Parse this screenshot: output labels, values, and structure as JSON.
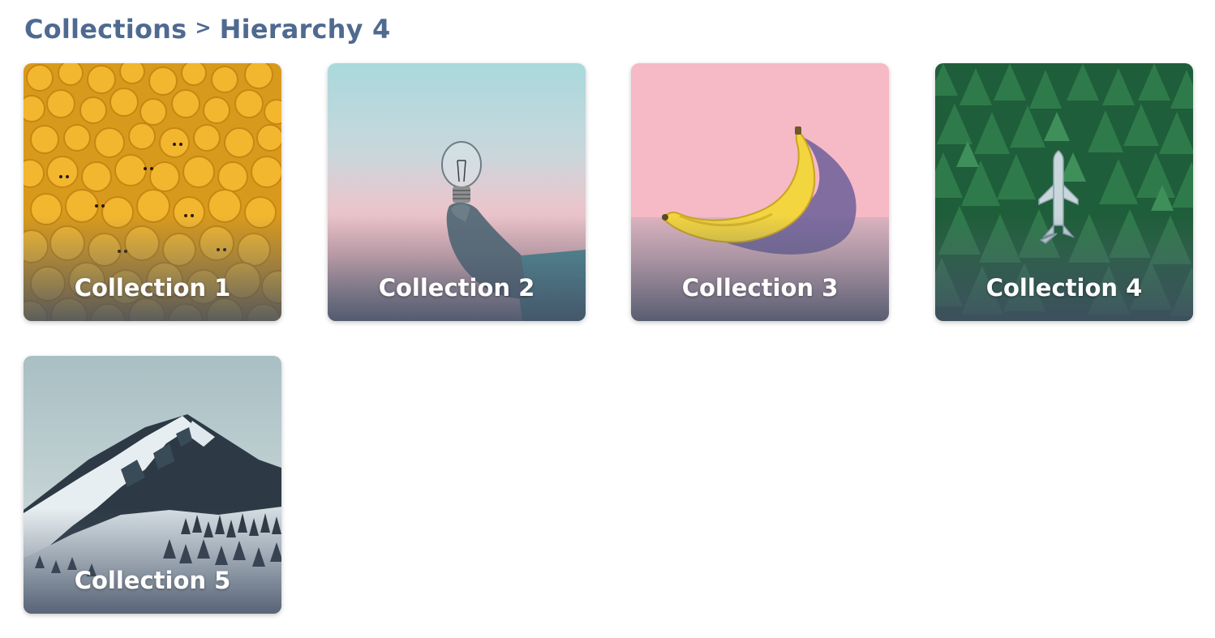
{
  "breadcrumb": {
    "root": "Collections",
    "separator": ">",
    "current": "Hierarchy 4"
  },
  "collections": [
    {
      "label": "Collection 1",
      "thumbnail": "yellow-toy-heads"
    },
    {
      "label": "Collection 2",
      "thumbnail": "lightbulb-in-hand"
    },
    {
      "label": "Collection 3",
      "thumbnail": "banana-on-pink"
    },
    {
      "label": "Collection 4",
      "thumbnail": "plane-in-forest"
    },
    {
      "label": "Collection 5",
      "thumbnail": "snowy-mountain"
    }
  ],
  "colors": {
    "breadcrumb_text": "#4f6a90",
    "card_label": "#ffffff"
  }
}
